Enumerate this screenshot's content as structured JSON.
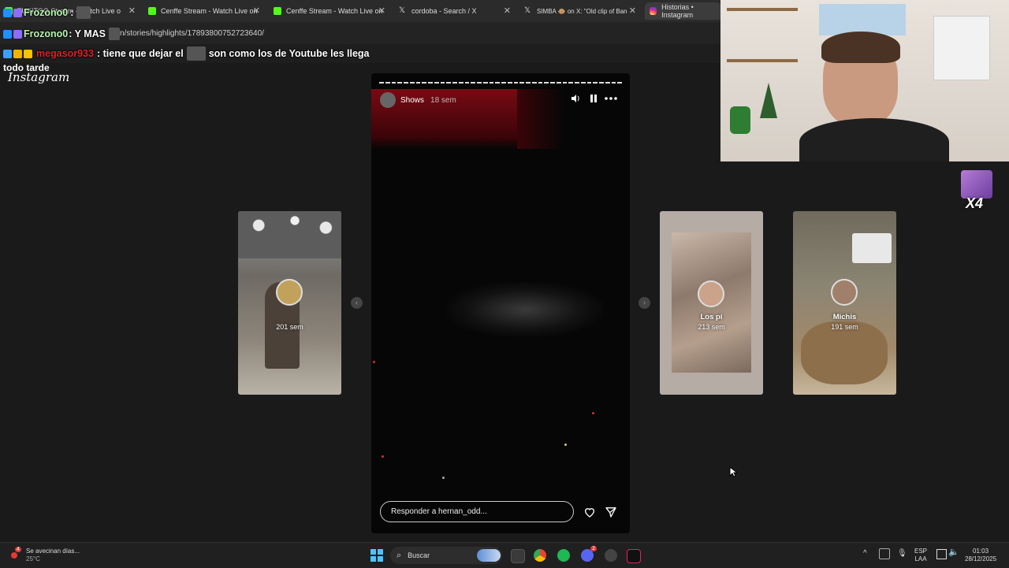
{
  "browser": {
    "tabs": [
      {
        "title": "TUKITOO Stream - Watch Live o"
      },
      {
        "title": "Cenffe Stream - Watch Live on"
      },
      {
        "title": "Cenffe Stream - Watch Live on"
      },
      {
        "title": "cordoba - Search / X"
      },
      {
        "title": "SIMBA 🐵 on X: \"Old clip of Ban"
      },
      {
        "title": "Historias • Instagram"
      }
    ],
    "url": "n/stories/highlights/17893800752723640/"
  },
  "chat": [
    {
      "user": "Frozono0",
      "message": ":"
    },
    {
      "user": "Frozono0",
      "message": ": Y MAS"
    },
    {
      "user": "megasor933",
      "message": ": tiene que dejar el",
      "message2": "son como los de Youtube les llega"
    }
  ],
  "overlay": {
    "top_text": "todo tarde",
    "brand": "Instagram"
  },
  "story": {
    "user": "Shows",
    "time": "18 sem",
    "reply_placeholder": "Responder a hernan_odd...",
    "progress_segments": 40
  },
  "cards": [
    {
      "label": "",
      "time": "201 sem"
    },
    {
      "label": "Los pi",
      "time": "213 sem"
    },
    {
      "label": "Michis",
      "time": "191 sem"
    }
  ],
  "side": {
    "badge": "X4"
  },
  "taskbar": {
    "weather_text": "Se avecinan días...",
    "weather_temp": "25°C",
    "weather_badge": "4",
    "search_label": "Buscar",
    "lang_top": "ESP",
    "lang_bottom": "LAA",
    "time": "01:03",
    "date": "28/12/2025",
    "discord_badge": "2"
  },
  "colors": {
    "accent_red": "#7a0a12",
    "background": "#1a1a1a",
    "taskbar": "#202020"
  }
}
